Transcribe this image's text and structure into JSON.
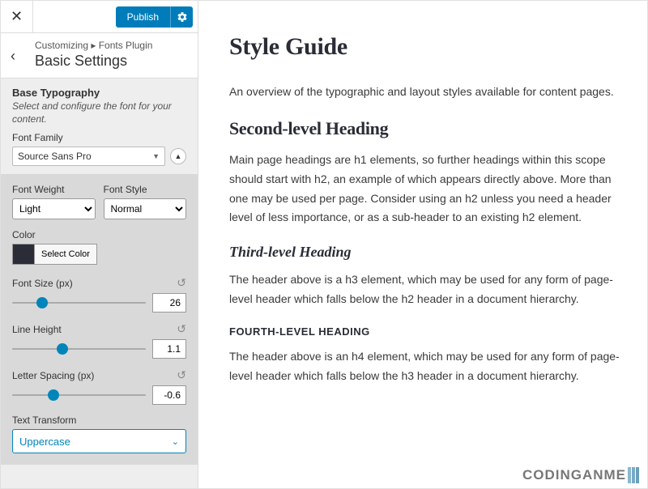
{
  "topbar": {
    "publish": "Publish"
  },
  "breadcrumb": {
    "prefix": "Customizing ▸ Fonts Plugin",
    "title": "Basic Settings"
  },
  "base": {
    "section_title": "Base Typography",
    "section_desc": "Select and configure the font for your content.",
    "font_family_label": "Font Family",
    "font_family_value": "Source Sans Pro"
  },
  "adv": {
    "weight_label": "Font Weight",
    "weight_value": "Light",
    "style_label": "Font Style",
    "style_value": "Normal",
    "color_label": "Color",
    "color_swatch": "#2a2c36",
    "select_color": "Select Color",
    "font_size_label": "Font Size (px)",
    "font_size_value": "26",
    "line_height_label": "Line Height",
    "line_height_value": "1.1",
    "letter_spacing_label": "Letter Spacing (px)",
    "letter_spacing_value": "-0.6",
    "transform_label": "Text Transform",
    "transform_value": "Uppercase"
  },
  "preview": {
    "h1": "Style Guide",
    "intro": "An overview of the typographic and layout styles available for content pages.",
    "h2": "Second-level Heading",
    "p2": "Main page headings are h1 elements, so further headings within this scope should start with h2, an example of which appears directly above. More than one may be used per page. Consider using an h2 unless you need a header level of less importance, or as a sub-header to an existing h2 element.",
    "h3": "Third-level Heading",
    "p3": "The header above is a h3 element, which may be used for any form of page-level header which falls below the h2 header in a document hierarchy.",
    "h4": "Fourth-Level Heading",
    "p4": "The header above is an h4 element, which may be used for any form of page-level header which falls below the h3 header in a document hierarchy."
  },
  "watermark": "CODINGANME"
}
